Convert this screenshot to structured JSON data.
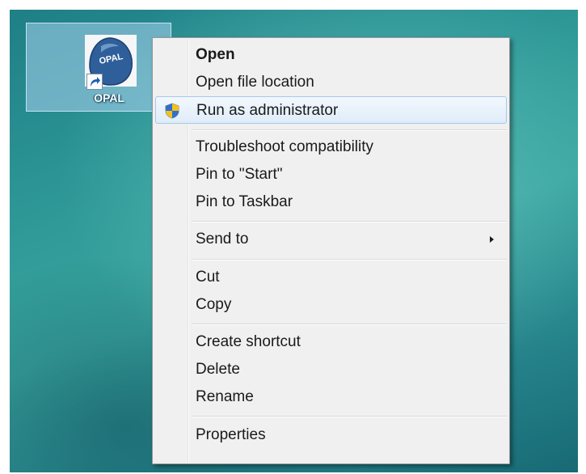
{
  "desktop": {
    "icon": {
      "label": "OPAL",
      "logo_text": "OPAL"
    }
  },
  "context_menu": {
    "items": [
      {
        "label": "Open",
        "bold": true
      },
      {
        "label": "Open file location"
      },
      {
        "label": "Run as administrator",
        "icon": "uac-shield-icon",
        "highlighted": true
      },
      {
        "label": "Troubleshoot compatibility"
      },
      {
        "label": "Pin to \"Start\""
      },
      {
        "label": "Pin to Taskbar"
      },
      {
        "label": "Send to",
        "submenu": true
      },
      {
        "label": "Cut"
      },
      {
        "label": "Copy"
      },
      {
        "label": "Create shortcut"
      },
      {
        "label": "Delete"
      },
      {
        "label": "Rename"
      },
      {
        "label": "Properties"
      }
    ]
  },
  "colors": {
    "desktop_teal": "#2f9a98",
    "menu_background": "#f0f0f0",
    "highlight_border": "#a8c8ea"
  }
}
